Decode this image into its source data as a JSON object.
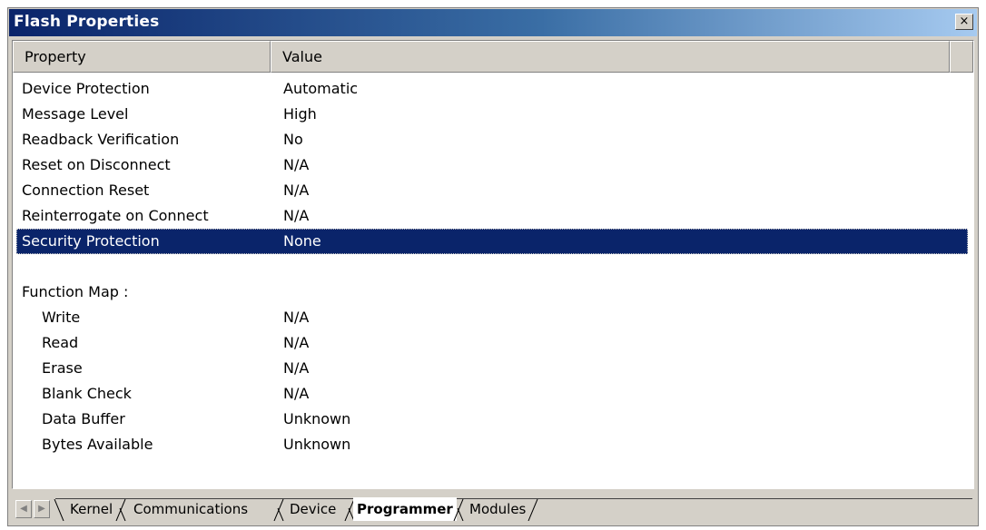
{
  "window": {
    "title": "Flash Properties",
    "close_glyph": "×"
  },
  "columns": {
    "property": "Property",
    "value": "Value"
  },
  "properties": [
    {
      "name": "Device Protection",
      "value": "Automatic"
    },
    {
      "name": "Message Level",
      "value": "High"
    },
    {
      "name": "Readback Verification",
      "value": "No"
    },
    {
      "name": "Reset on Disconnect",
      "value": "N/A"
    },
    {
      "name": "Connection Reset",
      "value": "N/A"
    },
    {
      "name": "Reinterrogate on Connect",
      "value": "N/A"
    },
    {
      "name": "Security Protection",
      "value": "None",
      "selected": true
    }
  ],
  "function_map": {
    "heading": "Function Map :",
    "items": [
      {
        "name": "Write",
        "value": "N/A"
      },
      {
        "name": "Read",
        "value": "N/A"
      },
      {
        "name": "Erase",
        "value": "N/A"
      },
      {
        "name": "Blank Check",
        "value": "N/A"
      },
      {
        "name": "Data Buffer",
        "value": "Unknown"
      },
      {
        "name": "Bytes Available",
        "value": "Unknown"
      }
    ]
  },
  "tabs": {
    "scroll_left_glyph": "◀",
    "scroll_right_glyph": "▶",
    "items": [
      {
        "label": "Kernel",
        "active": false
      },
      {
        "label": "Communications",
        "active": false
      },
      {
        "label": "Device",
        "active": false
      },
      {
        "label": "Programmer",
        "active": true
      },
      {
        "label": "Modules",
        "active": false
      }
    ]
  },
  "colors": {
    "title_bar": "#0a246a",
    "selection": "#0a246a",
    "face": "#d4d0c8"
  }
}
